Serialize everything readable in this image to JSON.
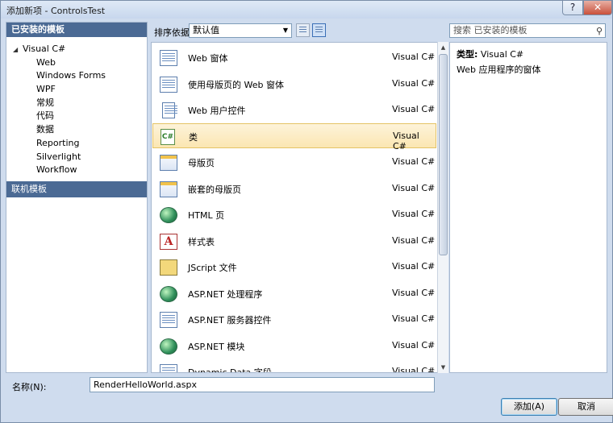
{
  "window": {
    "title": "添加新项 - ControlsTest",
    "help": "?",
    "close": "✕"
  },
  "left": {
    "installed_header": "已安装的模板",
    "root": "Visual C#",
    "children": [
      "Web",
      "Windows Forms",
      "WPF",
      "常规",
      "代码",
      "数据",
      "Reporting",
      "Silverlight",
      "Workflow"
    ],
    "online_header": "联机模板"
  },
  "toolbar": {
    "sort_label": "排序依据:",
    "sort_value": "默认值",
    "search_placeholder": "搜索 已安装的模板"
  },
  "items": [
    {
      "name": "Web 窗体",
      "lang": "Visual C#",
      "icon": "web-form-icon"
    },
    {
      "name": "使用母版页的 Web 窗体",
      "lang": "Visual C#",
      "icon": "web-form-master-icon"
    },
    {
      "name": "Web 用户控件",
      "lang": "Visual C#",
      "icon": "user-control-icon"
    },
    {
      "name": "类",
      "lang": "Visual C#",
      "icon": "class-icon",
      "selected": true
    },
    {
      "name": "母版页",
      "lang": "Visual C#",
      "icon": "master-page-icon"
    },
    {
      "name": "嵌套的母版页",
      "lang": "Visual C#",
      "icon": "nested-master-page-icon"
    },
    {
      "name": "HTML 页",
      "lang": "Visual C#",
      "icon": "html-page-icon"
    },
    {
      "name": "样式表",
      "lang": "Visual C#",
      "icon": "stylesheet-icon"
    },
    {
      "name": "JScript 文件",
      "lang": "Visual C#",
      "icon": "jscript-file-icon"
    },
    {
      "name": "ASP.NET 处理程序",
      "lang": "Visual C#",
      "icon": "handler-icon"
    },
    {
      "name": "ASP.NET 服务器控件",
      "lang": "Visual C#",
      "icon": "server-control-icon"
    },
    {
      "name": "ASP.NET 模块",
      "lang": "Visual C#",
      "icon": "module-icon"
    },
    {
      "name": "Dynamic Data 字段",
      "lang": "Visual C#",
      "icon": "dynamic-data-icon"
    }
  ],
  "details": {
    "type_label": "类型:",
    "type_value": "Visual C#",
    "description": "Web 应用程序的窗体"
  },
  "bottom": {
    "name_label": "名称(N):",
    "name_value": "RenderHelloWorld.aspx",
    "add_button": "添加(A)",
    "cancel_button": "取消"
  }
}
